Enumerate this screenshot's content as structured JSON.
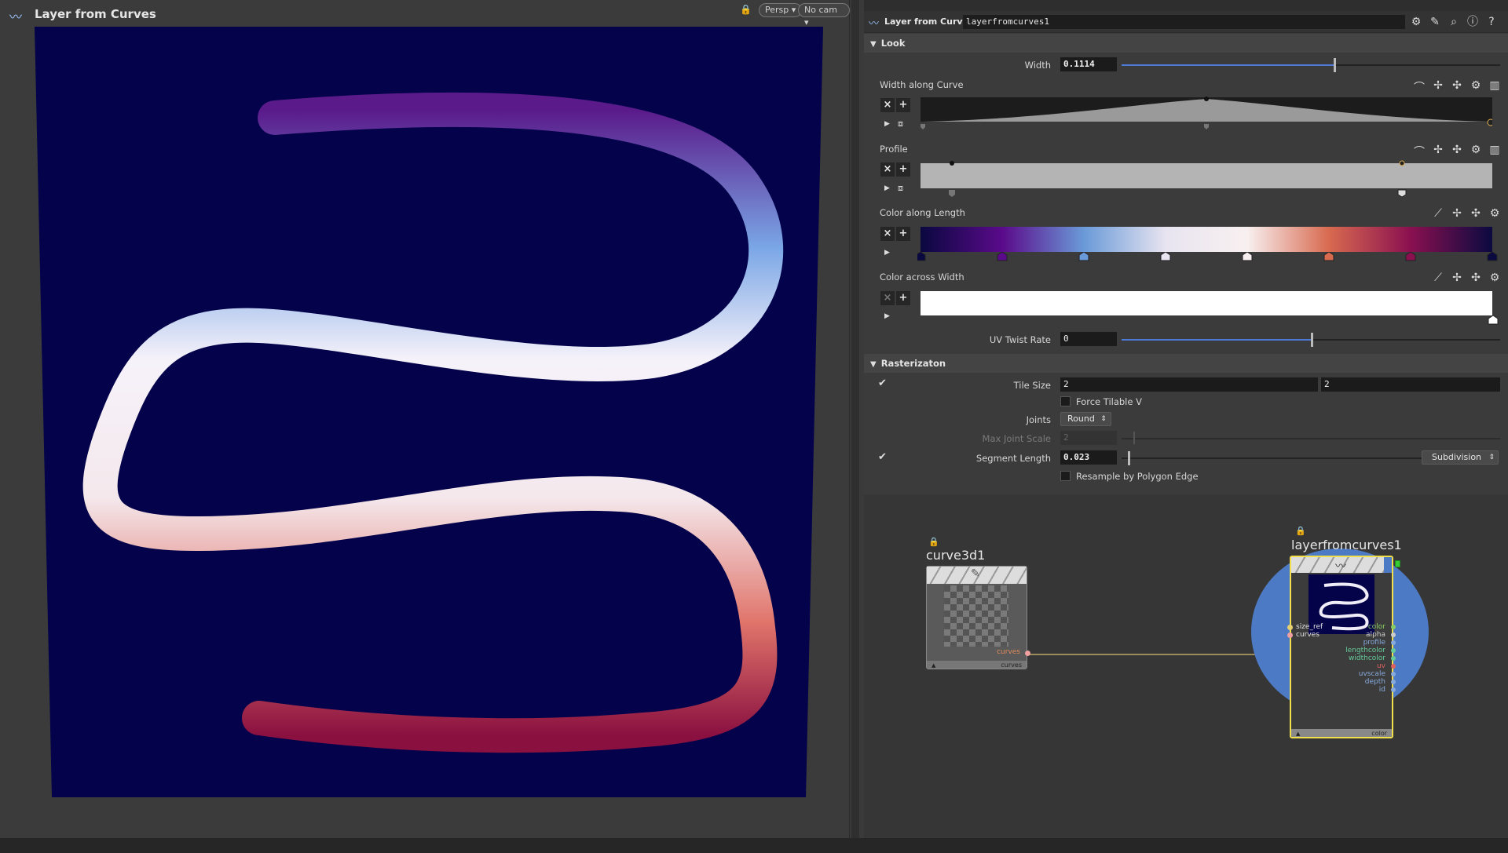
{
  "viewport": {
    "title": "Layer from Curves",
    "lock_icon": "lock-icon",
    "persp_label": "Persp",
    "cam_label": "No cam"
  },
  "parms": {
    "node_type_label": "Layer from Curves",
    "node_name": "layerfromcurves1",
    "header_icons": [
      "gear-icon",
      "brush-icon",
      "search-icon",
      "info-icon",
      "help-icon"
    ],
    "look": {
      "section_label": "Look",
      "width_label": "Width",
      "width_value": "0.1114",
      "width_fraction": 0.56,
      "width_along_curve_label": "Width along Curve",
      "profile_label": "Profile",
      "color_along_length_label": "Color along Length",
      "color_along_length_stops": [
        "#0a0840",
        "#5a0a8a",
        "#6a9ad8",
        "#e8e4f0",
        "#f8f0f0",
        "#d86a50",
        "#8a1050",
        "#0a0a40"
      ],
      "color_across_width_label": "Color across Width",
      "uv_twist_label": "UV Twist Rate",
      "uv_twist_value": "0",
      "uv_twist_fraction": 0.5
    },
    "raster": {
      "section_label": "Rasterizaton",
      "tile_size_label": "Tile Size",
      "tile_size_x": "2",
      "tile_size_y": "2",
      "force_tilable_label": "Force Tilable V",
      "joints_label": "Joints",
      "joints_value": "Round",
      "max_joint_label": "Max Joint Scale",
      "max_joint_value": "2",
      "segment_length_label": "Segment Length",
      "segment_length_value": "0.023",
      "segment_mode_value": "Subdivision",
      "resample_label": "Resample by Polygon Edge"
    }
  },
  "network": {
    "curve_node": {
      "name": "curve3d1",
      "output_port": "curves",
      "footer_label": "curves"
    },
    "layer_node": {
      "name": "layerfromcurves1",
      "inputs": [
        "size_ref",
        "curves"
      ],
      "outputs": [
        "color",
        "alpha",
        "profile",
        "lengthcolor",
        "widthcolor",
        "uv",
        "uvscale",
        "depth",
        "id"
      ],
      "footer_label": "color"
    }
  }
}
